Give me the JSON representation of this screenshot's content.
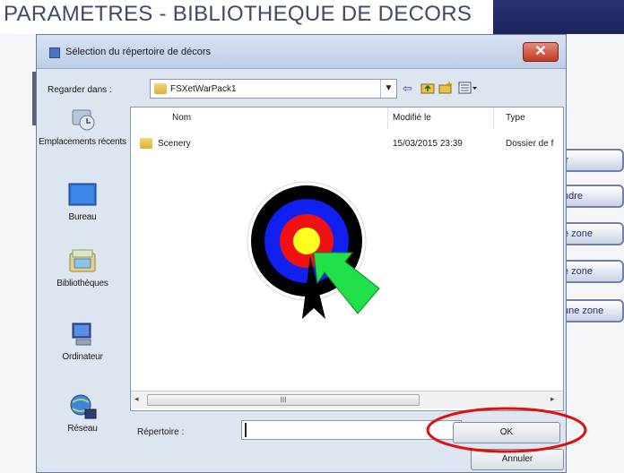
{
  "background": {
    "title": "PARAMETRES - BIBLIOTHEQUE DE DECORS",
    "buttons": [
      "ir",
      "ndre",
      "e zone",
      "e zone",
      "une zone"
    ]
  },
  "dialog": {
    "title": "Sélection du répertoire de décors",
    "close_label": "✕",
    "look_in_label": "Regarder dans :",
    "look_in_value": "FSXetWarPack1",
    "places": [
      {
        "label": "Emplacements récents",
        "icon": "recent-places-icon"
      },
      {
        "label": "Bureau",
        "icon": "desktop-icon"
      },
      {
        "label": "Bibliothèques",
        "icon": "libraries-icon"
      },
      {
        "label": "Ordinateur",
        "icon": "computer-icon"
      },
      {
        "label": "Réseau",
        "icon": "network-icon"
      }
    ],
    "columns": {
      "name": "Nom",
      "modified": "Modifié le",
      "type": "Type"
    },
    "rows": [
      {
        "name": "Scenery",
        "modified": "15/03/2015 23:39",
        "type": "Dossier de f"
      }
    ],
    "scroll_grip": "III",
    "directory_label": "Répertoire :",
    "directory_value": "",
    "ok_label": "OK",
    "cancel_label": "Annuler"
  },
  "annotations": {
    "target_colors": [
      "#000000",
      "#0000ff",
      "#ff0000",
      "#ffff00"
    ],
    "arrow_color": "#22e04a",
    "ellipse_color": "#e01010"
  }
}
